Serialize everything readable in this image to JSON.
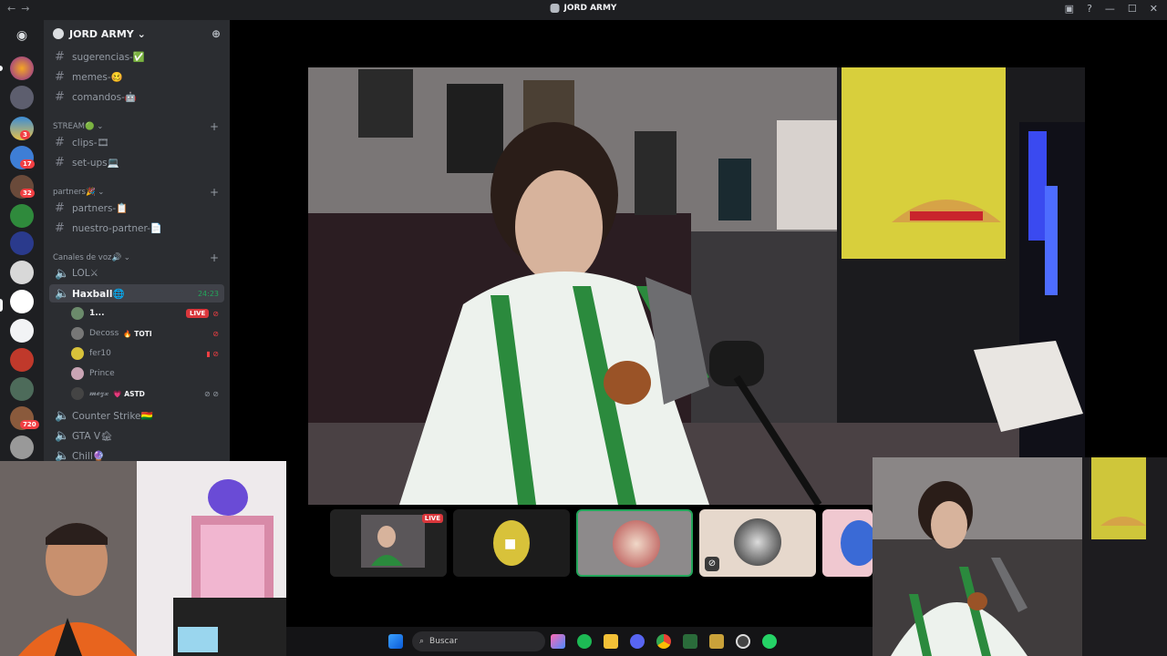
{
  "window": {
    "title": "JORD ARMY",
    "nav_back": "←",
    "nav_forward": "→"
  },
  "guild": {
    "name": "JORD ARMY ⌄"
  },
  "rail": {
    "badges": [
      "3",
      "17",
      "32",
      "720"
    ]
  },
  "channels_top": [
    {
      "name": "sugerencias-✅"
    },
    {
      "name": "memes-🥴"
    },
    {
      "name": "comandos-🤖"
    }
  ],
  "categories": {
    "stream": "STREAM🟢 ⌄",
    "partners": "partners🎉 ⌄",
    "voz": "Canales de voz🔊 ⌄"
  },
  "stream_channels": [
    {
      "name": "clips-🎞"
    },
    {
      "name": "set-ups💻"
    }
  ],
  "partner_channels": [
    {
      "name": "partners-📋"
    },
    {
      "name": "nuestro-partner-📄"
    }
  ],
  "voice_channels": {
    "lol": "LOL⚔",
    "haxball": "Haxball🌐",
    "haxball_time": "24:23",
    "counter": "Counter Strike🇧🇴",
    "gta": "GTA V🏚",
    "chill": "Chill🔮"
  },
  "voice_users": [
    {
      "name": "1...",
      "tag": "",
      "live": "LIVE"
    },
    {
      "name": "Decoss",
      "tag": "🔥 TOTI",
      "live": ""
    },
    {
      "name": "fer10",
      "tag": "",
      "live": ""
    },
    {
      "name": "Prince",
      "tag": "",
      "live": ""
    },
    {
      "name": "𝓶𝓮𝔃𝔁",
      "tag": "💗 ASTD",
      "live": ""
    }
  ],
  "thumbs": {
    "live_badge": "LIVE"
  },
  "taskbar": {
    "search_placeholder": "Buscar"
  },
  "colors": {
    "discord_bg": "#2b2d31",
    "rail_bg": "#1e1f22",
    "live_red": "#da373c",
    "online_green": "#23a55a"
  }
}
